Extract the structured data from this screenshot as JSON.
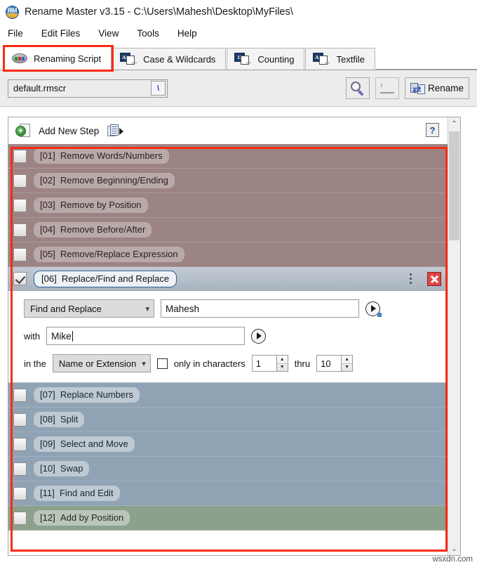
{
  "window": {
    "app_icon_label": "RM",
    "title": "Rename Master v3.15 - C:\\Users\\Mahesh\\Desktop\\MyFiles\\"
  },
  "menubar": {
    "items": [
      {
        "label": "File"
      },
      {
        "label": "Edit Files"
      },
      {
        "label": "View"
      },
      {
        "label": "Tools"
      },
      {
        "label": "Help"
      }
    ]
  },
  "tabs": [
    {
      "label": "Renaming Script",
      "icon": "renaming-script-icon",
      "active": true
    },
    {
      "label": "Case & Wildcards",
      "icon": "ab-files-icon",
      "badge": "Ab",
      "active": false
    },
    {
      "label": "Counting",
      "icon": "number-files-icon",
      "badge": "12",
      "active": false
    },
    {
      "label": "Textfile",
      "icon": "ab-files-icon",
      "badge": "Ab",
      "active": false
    }
  ],
  "script_bar": {
    "script_combo": {
      "value": "default.rmscr",
      "dropdown_glyph": "\\"
    },
    "preview_button": {
      "name": "preview-button",
      "icon": "magnifier-icon"
    },
    "secondary_button": {
      "name": "undo-button",
      "icon": "faded-icon",
      "disabled": true
    },
    "rename_button": {
      "label": "Rename",
      "icon": "rename-arrows-icon"
    }
  },
  "panel": {
    "add_new_step": {
      "label": "Add New Step",
      "icon": "add-step-icon"
    },
    "clipboard_button": {
      "icon": "copy-steps-icon"
    },
    "help_button": {
      "label": "?"
    }
  },
  "steps": [
    {
      "num": "[01]",
      "label": "Remove Words/Numbers",
      "checked": false,
      "tone": "tone-red"
    },
    {
      "num": "[02]",
      "label": "Remove Beginning/Ending",
      "checked": false,
      "tone": "tone-red"
    },
    {
      "num": "[03]",
      "label": "Remove by Position",
      "checked": false,
      "tone": "tone-red"
    },
    {
      "num": "[04]",
      "label": "Remove Before/After",
      "checked": false,
      "tone": "tone-red"
    },
    {
      "num": "[05]",
      "label": "Remove/Replace Expression",
      "checked": false,
      "tone": "tone-red"
    },
    {
      "num": "[07]",
      "label": "Replace Numbers",
      "checked": false,
      "tone": "tone-blue"
    },
    {
      "num": "[08]",
      "label": "Split",
      "checked": false,
      "tone": "tone-blue"
    },
    {
      "num": "[09]",
      "label": "Select and Move",
      "checked": false,
      "tone": "tone-blue"
    },
    {
      "num": "[10]",
      "label": "Swap",
      "checked": false,
      "tone": "tone-blue"
    },
    {
      "num": "[11]",
      "label": "Find and Edit",
      "checked": false,
      "tone": "tone-blue"
    },
    {
      "num": "[12]",
      "label": "Add by Position",
      "checked": false,
      "tone": "tone-green"
    }
  ],
  "expanded_step": {
    "num": "[06]",
    "label": "Replace/Find and Replace",
    "checked": true,
    "mode_select": {
      "value": "Find and Replace"
    },
    "find_field": {
      "value": "Mahesh"
    },
    "with_label": "with",
    "with_field": {
      "value": "Mike"
    },
    "in_the_label": "in the",
    "scope_select": {
      "value": "Name or Extension"
    },
    "only_in_characters": {
      "label": "only in characters",
      "checked": false
    },
    "from_value": "1",
    "thru_label": "thru",
    "to_value": "10"
  },
  "scrollbar": {
    "up_glyph": "⌃",
    "down_glyph": "⌄"
  },
  "watermark": "wsxdn.com",
  "colors": {
    "annotation_red": "#fa2b15",
    "step_remove": "#9d8484",
    "step_replace": "#8fa3b4",
    "step_add": "#8ba18b",
    "accent_blue": "#2f5f9e"
  }
}
